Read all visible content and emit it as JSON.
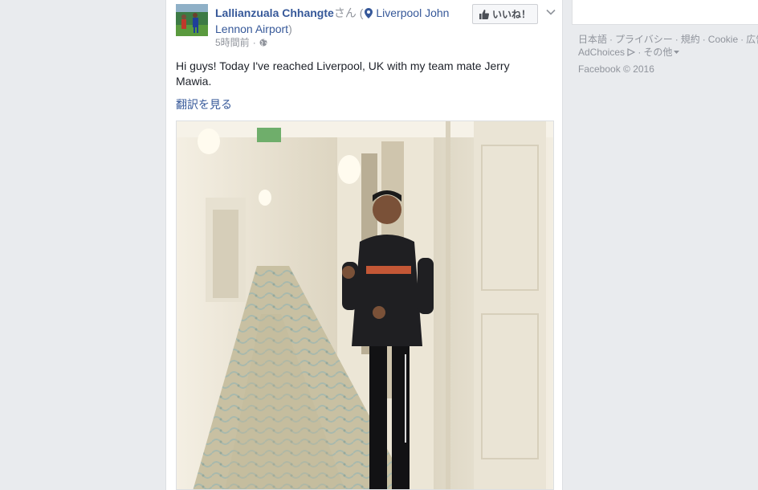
{
  "post": {
    "author_name": "Lallianzuala Chhangte",
    "author_suffix": "さん",
    "open_paren": " (",
    "location": "Liverpool John Lennon Airport",
    "close_paren": ")",
    "time": "5時間前",
    "meta_separator": "·",
    "privacy_icon": "globe-icon",
    "like_label": "いいね！",
    "body": "Hi guys! Today I've reached Liverpool, UK with my team mate Jerry Mawia.",
    "translate_label": "翻訳を見る"
  },
  "sidebar": {
    "footer_links": [
      "日本語",
      "プライバシー",
      "規約",
      "Cookie",
      "広告"
    ],
    "adchoices_label": "AdChoices",
    "more_label": "その他",
    "separator": "·",
    "copyright": "Facebook © 2016"
  },
  "colors": {
    "link": "#365899",
    "muted": "#90949c",
    "background": "#e9ebee"
  }
}
